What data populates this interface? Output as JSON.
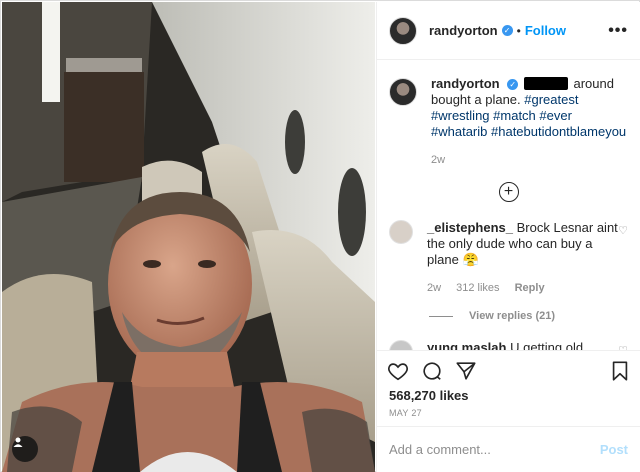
{
  "post": {
    "username": "randyorton",
    "follow_label": "Follow",
    "dot": "•",
    "more_label": "•••",
    "verified_mark": "✓"
  },
  "caption": {
    "username": "randyorton",
    "text_before_tags": "around bought a plane.",
    "tags": [
      "#greatest",
      "#wrestling",
      "#match",
      "#ever",
      "#whatarib",
      "#hatebutidontblameyou"
    ],
    "age": "2w"
  },
  "load_more_label": "+",
  "comments": [
    {
      "username": "_elistephens_",
      "text": "Brock Lesnar aint the only dude who can buy a plane",
      "emoji": "😤",
      "age": "2w",
      "likes": "312 likes",
      "reply_label": "Reply",
      "view_replies": "View replies (21)"
    },
    {
      "username": "yung.maslah",
      "text": "U getting old randy",
      "emoji": "🤫"
    }
  ],
  "likes_count": "568,270 likes",
  "date": "MAY 27",
  "add_comment": {
    "placeholder": "Add a comment...",
    "post_label": "Post"
  },
  "icons": {
    "like": "heart-icon",
    "comment": "comment-icon",
    "share": "share-icon",
    "save": "bookmark-icon",
    "tagged_user": "user-tag-icon"
  },
  "colors": {
    "accent": "#0095f6",
    "hashtag": "#00376b",
    "muted": "#8e8e8e",
    "post_disabled": "#b2dffc"
  }
}
